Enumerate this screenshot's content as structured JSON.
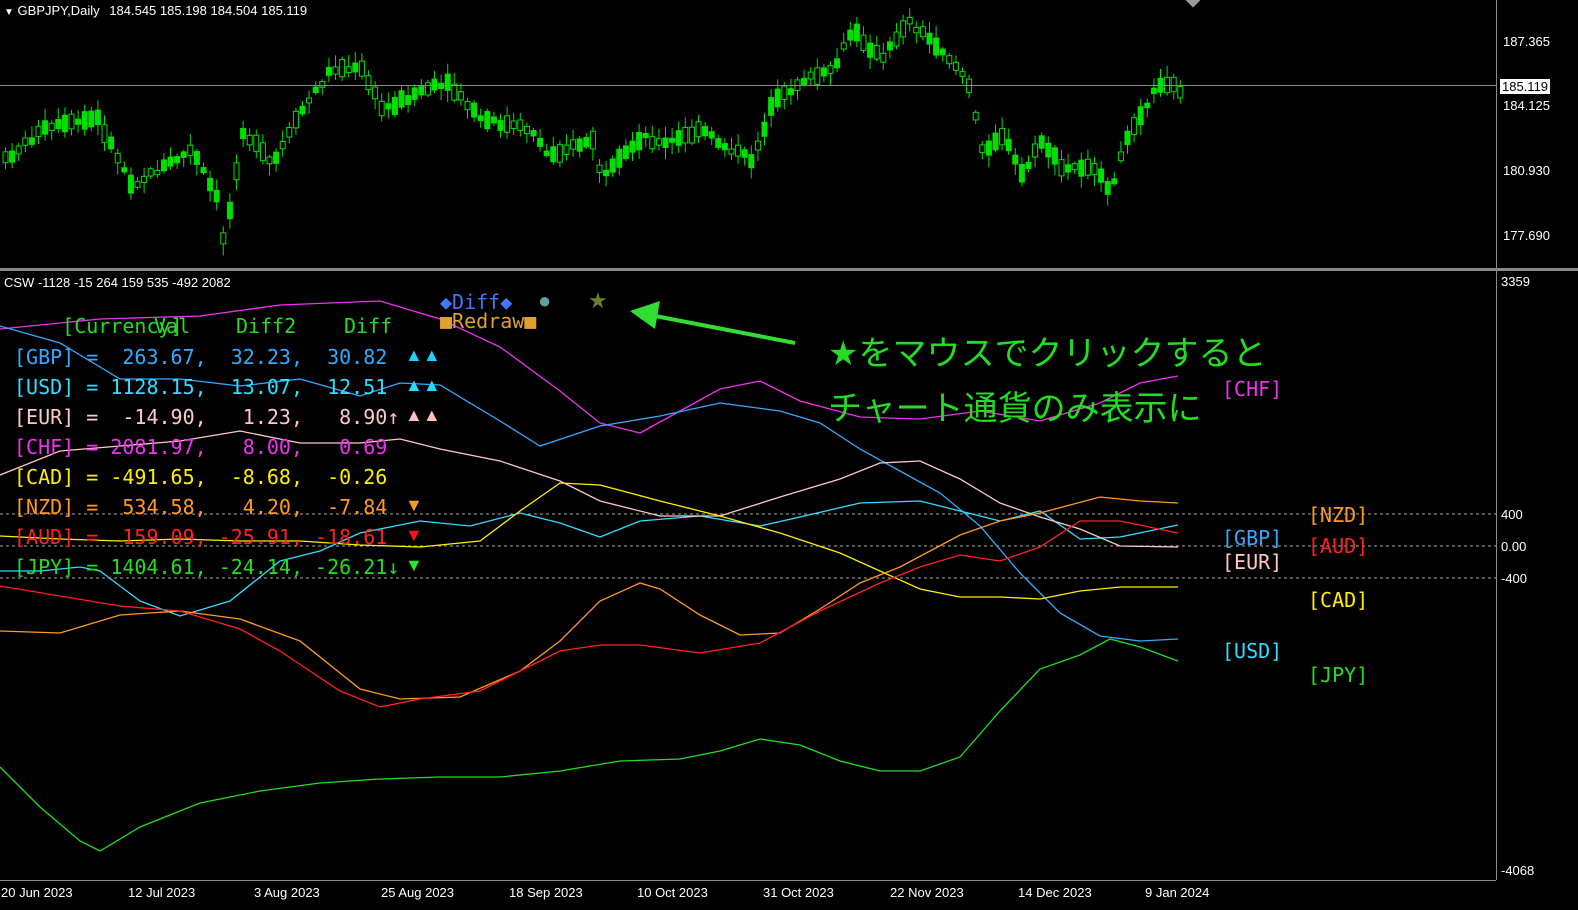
{
  "main_chart": {
    "title": "GBPJPY,Daily",
    "ohlc_text": "184.545 185.198 184.504 185.119",
    "current_price": "185.119",
    "price_ticks": [
      "187.365",
      "184.125",
      "180.930",
      "177.690"
    ],
    "candle_color": "#00e000"
  },
  "indicator": {
    "header": "CSW -1128 -15 264 159 535 -492 2082",
    "scale_top": "3359",
    "scale_bottom": "-4068",
    "levels": [
      "400",
      "0.00",
      "-400"
    ],
    "table_header": {
      "currency": "[Currency]",
      "val": "Val",
      "diff2": "Diff2",
      "diff": "Diff",
      "diff_button": "◆Diff◆",
      "circle_button": "●",
      "star_button": "★",
      "redraw_button": "■Redraw■"
    },
    "rows": [
      {
        "label": "[GBP]",
        "text": "[GBP] =  263.67,  32.23,  30.82",
        "arrows": "▲▲",
        "color": "#33aaff",
        "arrow_color": "#22ccff"
      },
      {
        "label": "[USD]",
        "text": "[USD] = 1128.15,  13.07,  12.51",
        "arrows": "▲▲",
        "color": "#33ddff",
        "arrow_color": "#22ddff"
      },
      {
        "label": "[EUR]",
        "text": "[EUR] =  -14.90,   1.23,   8.90↑",
        "arrows": "▲▲",
        "color": "#ffc8c8",
        "arrow_color": "#ffc0c0"
      },
      {
        "label": "[CHF]",
        "text": "[CHF] = 2081.97,   8.00,   0.69",
        "arrows": "",
        "color": "#ee33ee",
        "arrow_color": "#ee33ee"
      },
      {
        "label": "[CAD]",
        "text": "[CAD] = -491.65,  -8.68,  -0.26",
        "arrows": "",
        "color": "#ffee00",
        "arrow_color": "#ffee00"
      },
      {
        "label": "[NZD]",
        "text": "[NZD] =  534.58,   4.20,  -7.84",
        "arrows": "▼",
        "color": "#ff9922",
        "arrow_color": "#ff9922"
      },
      {
        "label": "[AUD]",
        "text": "[AUD] =  159.09, -25.91, -18.61",
        "arrows": "▼",
        "color": "#ff2222",
        "arrow_color": "#ff1111"
      },
      {
        "label": "[JPY]",
        "text": "[JPY] = 1404.61, -24.14, -26.21↓",
        "arrows": "▼",
        "color": "#22dd22",
        "arrow_color": "#22ee22"
      }
    ],
    "right_tags": {
      "chf": "[CHF]",
      "nzd": "[NZD]",
      "gbp": "[GBP]",
      "aud": "[AUD]",
      "eur": "[EUR]",
      "cad": "[CAD]",
      "usd": "[USD]",
      "jpy": "[JPY]"
    },
    "annotation_line1": "★をマウスでクリックすると",
    "annotation_line2": "チャート通貨のみ表示に"
  },
  "dates": [
    "20 Jun 2023",
    "12 Jul 2023",
    "3 Aug 2023",
    "25 Aug 2023",
    "18 Sep 2023",
    "10 Oct 2023",
    "31 Oct 2023",
    "22 Nov 2023",
    "14 Dec 2023",
    "9 Jan 2024"
  ],
  "colors": {
    "gbp": "#33aaff",
    "usd": "#33ddff",
    "eur": "#ffc8c8",
    "chf": "#ee33ee",
    "cad": "#ffee00",
    "nzd": "#ff9922",
    "aud": "#ff2222",
    "jpy": "#22dd22",
    "candle": "#00e000"
  }
}
